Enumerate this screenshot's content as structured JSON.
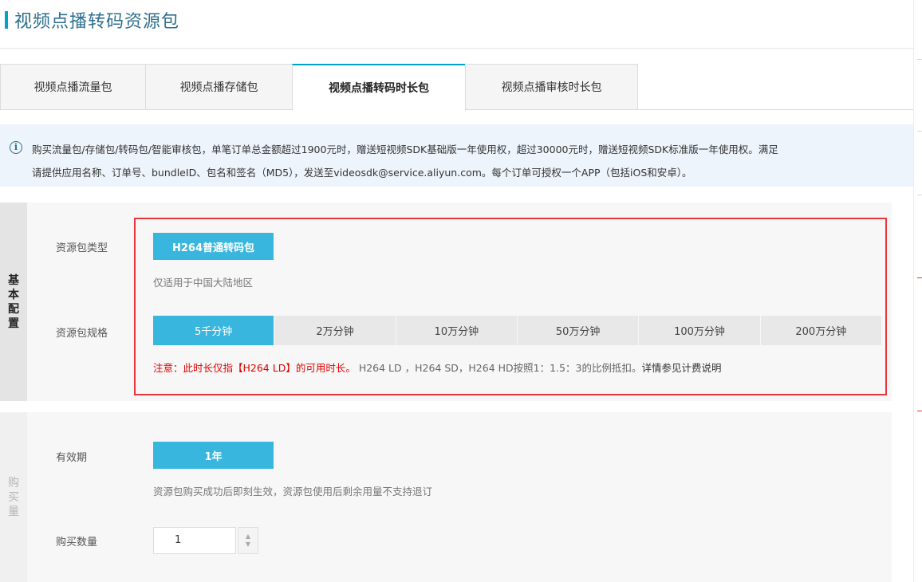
{
  "page": {
    "title": "视频点播转码资源包"
  },
  "tabs": [
    {
      "label": "视频点播流量包",
      "active": false
    },
    {
      "label": "视频点播存储包",
      "active": false
    },
    {
      "label": "视频点播转码时长包",
      "active": true
    },
    {
      "label": "视频点播审核时长包",
      "active": false
    }
  ],
  "notice": {
    "icon": "info-circle-icon",
    "line1": "购买流量包/存储包/转码包/智能审核包，单笔订单总金额超过1900元时，赠送短视频SDK基础版一年使用权，超过30000元时，赠送短视频SDK标准版一年使用权。满足",
    "line2": "请提供应用名称、订单号、bundleID、包名和签名（MD5），发送至videosdk@service.aliyun.com。每个订单可授权一个APP（包括iOS和安卓）。"
  },
  "basic_config": {
    "section_label": "基本配置",
    "package_type_label": "资源包类型",
    "package_type_value": "H264普通转码包",
    "package_type_hint": "仅适用于中国大陆地区",
    "spec_label": "资源包规格",
    "specs": [
      "5千分钟",
      "2万分钟",
      "10万分钟",
      "50万分钟",
      "100万分钟",
      "200万分钟"
    ],
    "selected_spec_index": 0,
    "note_red": "注意：此时长仅指【H264 LD】的可用时长。",
    "note_grey": "H264 LD ，H264 SD，H264 HD按照1：1.5：3的比例抵扣。",
    "note_link": "详情参见计费说明"
  },
  "purchase": {
    "section_label": "购买量",
    "validity_label": "有效期",
    "validity_value": "1年",
    "validity_hint": "资源包购买成功后即刻生效，资源包使用后剩余用量不支持退订",
    "quantity_label": "购买数量",
    "quantity_value": "1"
  },
  "colors": {
    "accent": "#39b6de",
    "title_blue": "#2e6f8e",
    "highlight_red": "#e8363c",
    "notice_bg": "#eef4fb"
  }
}
